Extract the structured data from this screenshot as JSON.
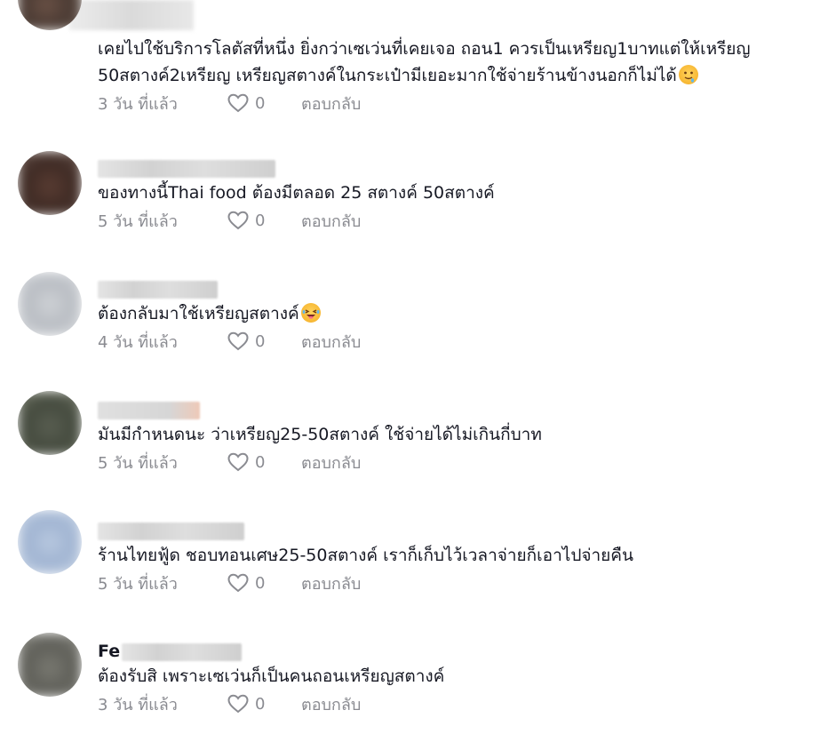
{
  "comments": [
    {
      "username_visible": "",
      "text": "เคยไปใช้บริการโลตัสที่หนึ่ง ยิ่งกว่าเซเว่นที่เคยเจอ ถอน1 ควรเป็นเหรียญ1บาทแต่ให้เหรียญ 50สตางค์2เหรียญ เหรียญสตางค์ในกระเป๋ามีเยอะมากใช้จ่ายร้านข้างนอกก็ไม่ได้",
      "emoji": "drooling-face-emoji",
      "time": "3 วัน ที่แล้ว",
      "likes": "0",
      "reply": "ตอบกลับ"
    },
    {
      "username_visible": "",
      "text": "ของทางนี้Thai food ต้องมีตลอด 25 สตางค์ 50สตางค์",
      "emoji": "",
      "time": "5 วัน ที่แล้ว",
      "likes": "0",
      "reply": "ตอบกลับ"
    },
    {
      "username_visible": "",
      "text": "ต้องกลับมาใช้เหรียญสตางค์",
      "emoji": "laughing-face-emoji",
      "time": "4 วัน ที่แล้ว",
      "likes": "0",
      "reply": "ตอบกลับ"
    },
    {
      "username_visible": "",
      "text": "มันมีกำหนดนะ ว่าเหรียญ25-50สตางค์ ใช้จ่ายได้ไม่เกินกี่บาท",
      "emoji": "",
      "time": "5 วัน ที่แล้ว",
      "likes": "0",
      "reply": "ตอบกลับ"
    },
    {
      "username_visible": "",
      "text": "ร้านไทยฟู้ด ชอบทอนเศษ25-50สตางค์ เราก็เก็บไว้เวลาจ่ายก็เอาไปจ่ายคืน",
      "emoji": "",
      "time": "5 วัน ที่แล้ว",
      "likes": "0",
      "reply": "ตอบกลับ"
    },
    {
      "username_visible": "Fe",
      "text": "ต้องรับสิ เพราะเซเว่นก็เป็นคนถอนเหรียญสตางค์",
      "emoji": "",
      "time": "3 วัน ที่แล้ว",
      "likes": "0",
      "reply": "ตอบกลับ"
    }
  ],
  "colors": {
    "text": "#161823",
    "meta": "#8a8b91",
    "background": "#ffffff"
  }
}
